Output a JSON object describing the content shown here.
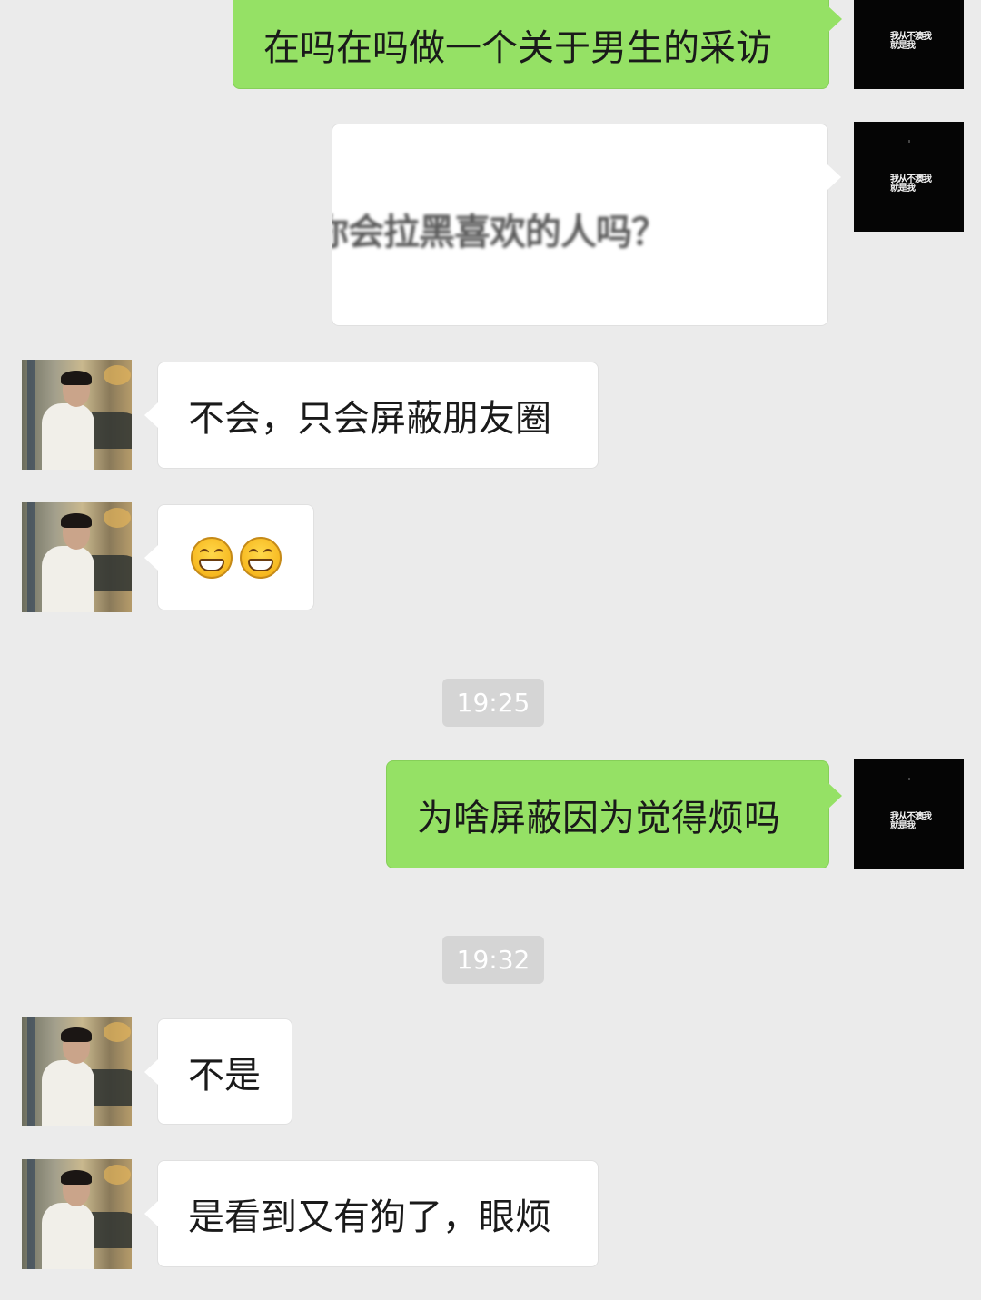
{
  "self_avatar": {
    "text": "我从不澳我就是我",
    "color": "#050505"
  },
  "other_avatar": {
    "description_icon": "user-photo-avatar"
  },
  "messages": [
    {
      "sender": "self",
      "type": "text",
      "text": "在吗在吗做一个关于男生的采访"
    },
    {
      "sender": "self",
      "type": "image",
      "text": "你会拉黑喜欢的人吗？"
    },
    {
      "sender": "other",
      "type": "text",
      "text": "不会，只会屏蔽朋友圈"
    },
    {
      "sender": "other",
      "type": "emoji",
      "emojis": [
        "grinning-face-icon",
        "grinning-face-icon"
      ]
    },
    {
      "type": "time",
      "text": "19:25"
    },
    {
      "sender": "self",
      "type": "text",
      "text": "为啥屏蔽因为觉得烦吗"
    },
    {
      "type": "time",
      "text": "19:32"
    },
    {
      "sender": "other",
      "type": "text",
      "text": "不是"
    },
    {
      "sender": "other",
      "type": "text",
      "text": "是看到又有狗了，眼烦"
    }
  ],
  "colors": {
    "background": "#ebebeb",
    "self_bubble": "#95e165",
    "other_bubble": "#ffffff",
    "time_badge": "#d5d5d5"
  }
}
